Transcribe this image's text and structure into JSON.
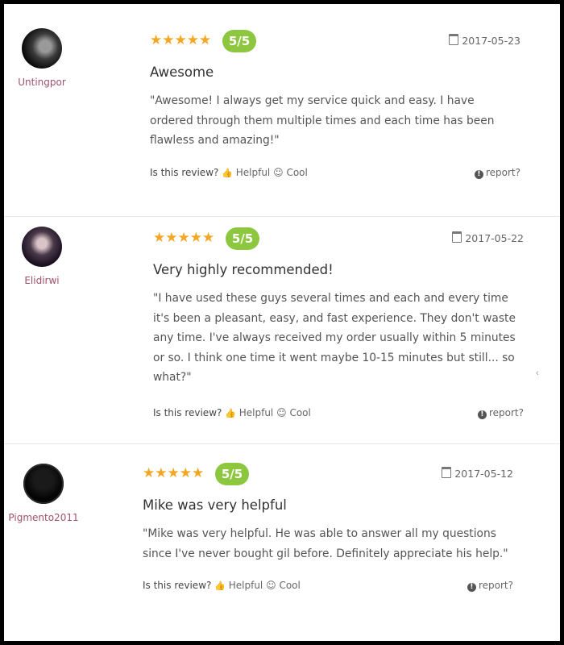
{
  "reviews": [
    {
      "username": "Untingpor",
      "avatar_icon": "user-avatar",
      "stars": "★★★★★",
      "score": "5/5",
      "date": "2017-05-23",
      "title": "Awesome",
      "text": "\"Awesome! I always get my service quick and easy. I have ordered through them multiple times and each time has been flawless and amazing!\"",
      "question": "Is this review?",
      "helpful_label": "Helpful",
      "cool_label": "Cool",
      "report_label": "report?"
    },
    {
      "username": "Elidirwi",
      "avatar_icon": "user-avatar",
      "stars": "★★★★★",
      "score": "5/5",
      "date": "2017-05-22",
      "title": "Very highly recommended!",
      "text": "\"I have used these guys several times and each and every time it's been a pleasant, easy, and fast experience. They don't waste any time. I've always received my order usually within 5 minutes or so. I think one time it went maybe 10-15 minutes but still... so what?\"",
      "question": "Is this review?",
      "helpful_label": "Helpful",
      "cool_label": "Cool",
      "report_label": "report?"
    },
    {
      "username": "Pigmento2011",
      "avatar_icon": "user-avatar",
      "stars": "★★★★★",
      "score": "5/5",
      "date": "2017-05-12",
      "title": "Mike was very helpful",
      "text": "\"Mike was very helpful. He was able to answer all my questions since I've never bought gil before. Definitely appreciate his help.\"",
      "question": "Is this review?",
      "helpful_label": "Helpful",
      "cool_label": "Cool",
      "report_label": "report?"
    }
  ],
  "colors": {
    "star": "#f5a623",
    "badge": "#8dc63f",
    "username": "#a0526a"
  }
}
